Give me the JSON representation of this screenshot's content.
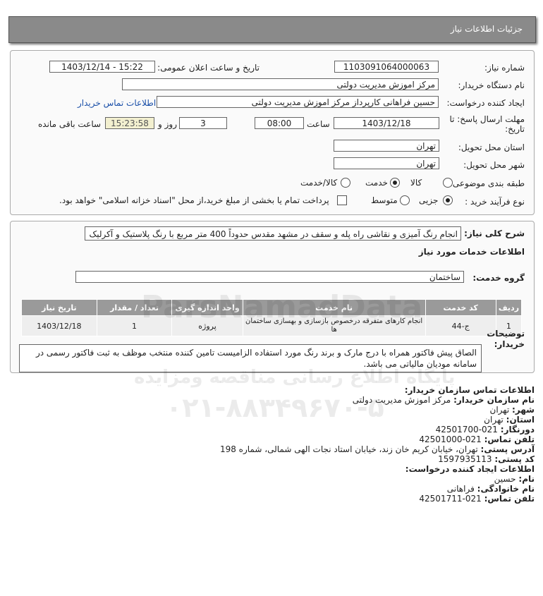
{
  "header": {
    "title": "جزئیات اطلاعات نیاز"
  },
  "form": {
    "need_number_label": "شماره نیاز:",
    "need_number": "1103091064000063",
    "announce_label": "تاریخ و ساعت اعلان عمومی:",
    "announce_value": "1403/12/14 - 15:22",
    "buyer_org_label": "نام دستگاه خریدار:",
    "buyer_org": "مرکز اموزش مدیریت دولتی",
    "creator_label": "ایجاد کننده درخواست:",
    "creator": "حسین  فراهانی کارپرداز مرکز اموزش مدیریت دولتی",
    "buyer_contact_link": "اطلاعات تماس خریدار",
    "deadline_label_1": "مهلت ارسال پاسخ: تا",
    "deadline_label_2": "تاریخ:",
    "deadline_date": "1403/12/18",
    "time_label": "ساعت",
    "deadline_time": "08:00",
    "days_value": "3",
    "days_label": "روز و",
    "remaining_time": "15:23:58",
    "remaining_label": "ساعت باقی مانده",
    "province_label": "استان محل تحویل:",
    "province": "تهران",
    "city_label": "شهر محل تحویل:",
    "city": "تهران",
    "category_label": "طبقه بندی موضوعی:",
    "category_options": [
      "کالا",
      "خدمت",
      "کالا/خدمت"
    ],
    "process_label": "نوع فرآیند خرید :",
    "process_options": [
      "جزیی",
      "متوسط"
    ],
    "payment_text": "پرداخت تمام یا بخشی از مبلغ خرید،از محل \"اسناد خزانه اسلامی\" خواهد بود."
  },
  "details": {
    "description_label": "شرح کلی نیاز:",
    "description": "انجام رنگ آمیزی و نقاشی راه پله و سقف در مشهد مقدس حدوداً 400 متر مربع با رنگ پلاستیک و آکرلیک",
    "services_heading": "اطلاعات خدمات مورد نیاز",
    "service_group_label": "گروه خدمت:",
    "service_group": "ساختمان",
    "table_headers": [
      "ردیف",
      "کد خدمت",
      "نام خدمت",
      "واحد اندازه گیری",
      "تعداد / مقدار",
      "تاریخ نیاز"
    ],
    "table_rows": [
      {
        "row": "1",
        "code": "ج-44",
        "name": "انجام کارهای متفرقه درخصوص بازسازی و بهسازی ساختمان ها",
        "unit": "پروژه",
        "qty": "1",
        "date": "1403/12/18"
      }
    ],
    "buyer_notes_label_1": "توضیحات",
    "buyer_notes_label_2": "خریدار:",
    "buyer_notes": "الصاق پیش فاکتور همراه با درج مارک و برند رنگ مورد استفاده الزامیست تامین کننده منتخب موظف به ثبت فاکتور رسمی در سامانه مودیان مالیاتی می باشد."
  },
  "contact": {
    "org_heading": "اطلاعات تماس سازمان خریدار:",
    "org_name_label": "نام سازمان خریدار:",
    "org_name": "مرکز اموزش مدیریت دولتی",
    "city_label": "شهر:",
    "city": "تهران",
    "province_label": "استان:",
    "province": "تهران",
    "fax_label": "دورنگار:",
    "fax": "021-42501700",
    "phone_label": "تلفن تماس:",
    "phone": "021-42501000",
    "address_label": "آدرس پستی:",
    "address": "تهران، خیابان کریم خان زند، خیابان استاد نجات الهی شمالی، شماره 198",
    "postal_label": "کد پستی:",
    "postal": "1597935113",
    "creator_heading": "اطلاعات ایجاد کننده درخواست:",
    "first_name_label": "نام:",
    "first_name": "حسین",
    "last_name_label": "نام خانوادگی:",
    "last_name": "فراهانی",
    "creator_phone_label": "تلفن تماس:",
    "creator_phone": "021-42501711"
  },
  "watermark": {
    "brand": "ParsNamadData",
    "line1": "پایگاه اطلاع رسانی مناقصه ومزایده",
    "phone": "۰۲۱-۸۸۳۴۹۶۷۰-۵"
  }
}
